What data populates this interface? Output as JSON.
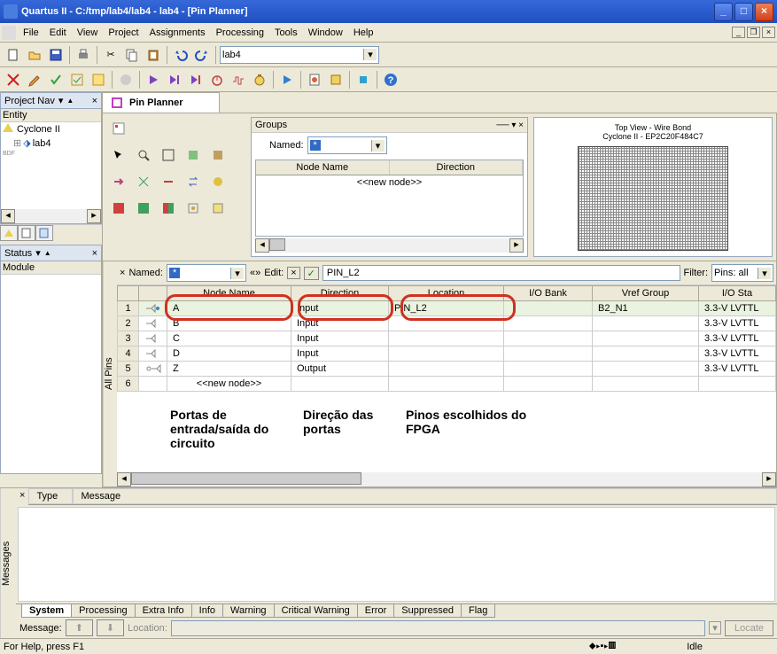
{
  "title": "Quartus II - C:/tmp/lab4/lab4 - lab4 - [Pin Planner]",
  "menu": [
    "File",
    "Edit",
    "View",
    "Project",
    "Assignments",
    "Processing",
    "Tools",
    "Window",
    "Help"
  ],
  "combo_project": "lab4",
  "panels": {
    "project_nav": {
      "title": "Project Nav",
      "header": "Entity",
      "items": [
        "Cyclone II",
        "lab4",
        "BDF"
      ]
    },
    "status": {
      "title": "Status",
      "header": "Module"
    }
  },
  "doctab": "Pin Planner",
  "groups": {
    "title": "Groups",
    "named_label": "Named:",
    "named_value": "*",
    "cols": [
      "Node Name",
      "Direction"
    ],
    "newnode": "<<new node>>"
  },
  "chip": {
    "line1": "Top View - Wire Bond",
    "line2": "Cyclone II - EP2C20F484C7"
  },
  "allpins": {
    "label": "All Pins",
    "named_label": "Named:",
    "named_value": "*",
    "edit_label": "Edit:",
    "edit_value": "PIN_L2",
    "filter_label": "Filter:",
    "filter_value": "Pins: all",
    "cols": [
      "",
      "",
      "Node Name",
      "Direction",
      "Location",
      "I/O Bank",
      "Vref Group",
      "I/O Sta"
    ],
    "rows": [
      {
        "n": "1",
        "name": "A",
        "dir": "Input",
        "loc": "PIN_L2",
        "bank": "",
        "vref": "B2_N1",
        "iost": "3.3-V LVTTL",
        "sel": true
      },
      {
        "n": "2",
        "name": "B",
        "dir": "Input",
        "loc": "",
        "bank": "",
        "vref": "",
        "iost": "3.3-V LVTTL"
      },
      {
        "n": "3",
        "name": "C",
        "dir": "Input",
        "loc": "",
        "bank": "",
        "vref": "",
        "iost": "3.3-V LVTTL"
      },
      {
        "n": "4",
        "name": "D",
        "dir": "Input",
        "loc": "",
        "bank": "",
        "vref": "",
        "iost": "3.3-V LVTTL"
      },
      {
        "n": "5",
        "name": "Z",
        "dir": "Output",
        "loc": "",
        "bank": "",
        "vref": "",
        "iost": "3.3-V LVTTL"
      },
      {
        "n": "6",
        "name": "<<new node>>",
        "dir": "",
        "loc": "",
        "bank": "",
        "vref": "",
        "iost": ""
      }
    ]
  },
  "annotations": {
    "a1": "Portas de entrada/saída do circuito",
    "a2": "Direção das portas",
    "a3": "Pinos escolhidos do FPGA"
  },
  "messages": {
    "label": "Messages",
    "cols": [
      "Type",
      "Message"
    ],
    "tabs": [
      "System",
      "Processing",
      "Extra Info",
      "Info",
      "Warning",
      "Critical Warning",
      "Error",
      "Suppressed",
      "Flag"
    ],
    "active_tab": 0,
    "msg_label": "Message:",
    "loc_label": "Location:",
    "locate_btn": "Locate"
  },
  "statusbar": {
    "help": "For Help, press F1",
    "state": "Idle"
  }
}
